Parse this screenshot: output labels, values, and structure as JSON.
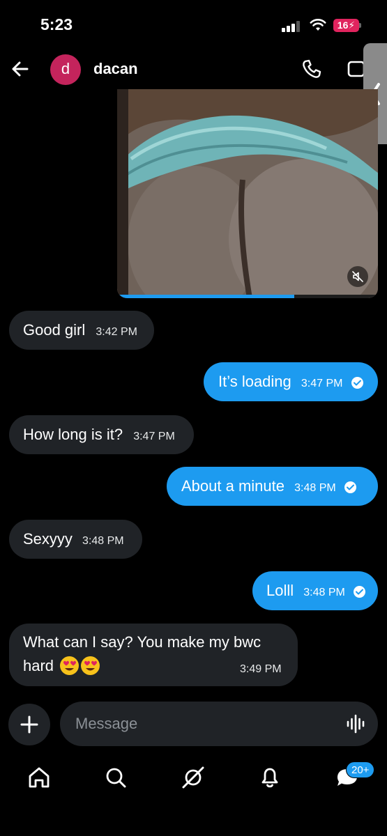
{
  "status_bar": {
    "time": "5:23",
    "battery_level": "16"
  },
  "header": {
    "avatar_letter": "d",
    "contact_name": "dacan"
  },
  "media": {
    "progress_fraction": 0.68
  },
  "messages": [
    {
      "direction": "received",
      "text": "Good girl",
      "time": "3:42 PM"
    },
    {
      "direction": "sent",
      "text": "It’s loading",
      "time": "3:47 PM",
      "read": true
    },
    {
      "direction": "received",
      "text": "How long is it?",
      "time": "3:47 PM"
    },
    {
      "direction": "sent",
      "text": "About a minute",
      "time": "3:48 PM",
      "read": true
    },
    {
      "direction": "received",
      "text": "Sexyyy",
      "time": "3:48 PM"
    },
    {
      "direction": "sent",
      "text": "Lolll",
      "time": "3:48 PM",
      "read": true
    },
    {
      "direction": "received",
      "text_line1": "What can I say? You make my bwc",
      "text_line2": "hard",
      "emojis": [
        "heart-eyes-emoji",
        "heart-eyes-emoji"
      ],
      "time": "3:49 PM"
    }
  ],
  "composer": {
    "placeholder": "Message"
  },
  "nav": {
    "items": [
      "home-icon",
      "search-icon",
      "grok-icon",
      "notifications-icon",
      "messages-icon"
    ],
    "messages_badge": "20+"
  },
  "colors": {
    "accent": "#1d9bf0",
    "bubble_received": "#202327",
    "avatar": "#c4245c",
    "battery": "#e0245e"
  }
}
